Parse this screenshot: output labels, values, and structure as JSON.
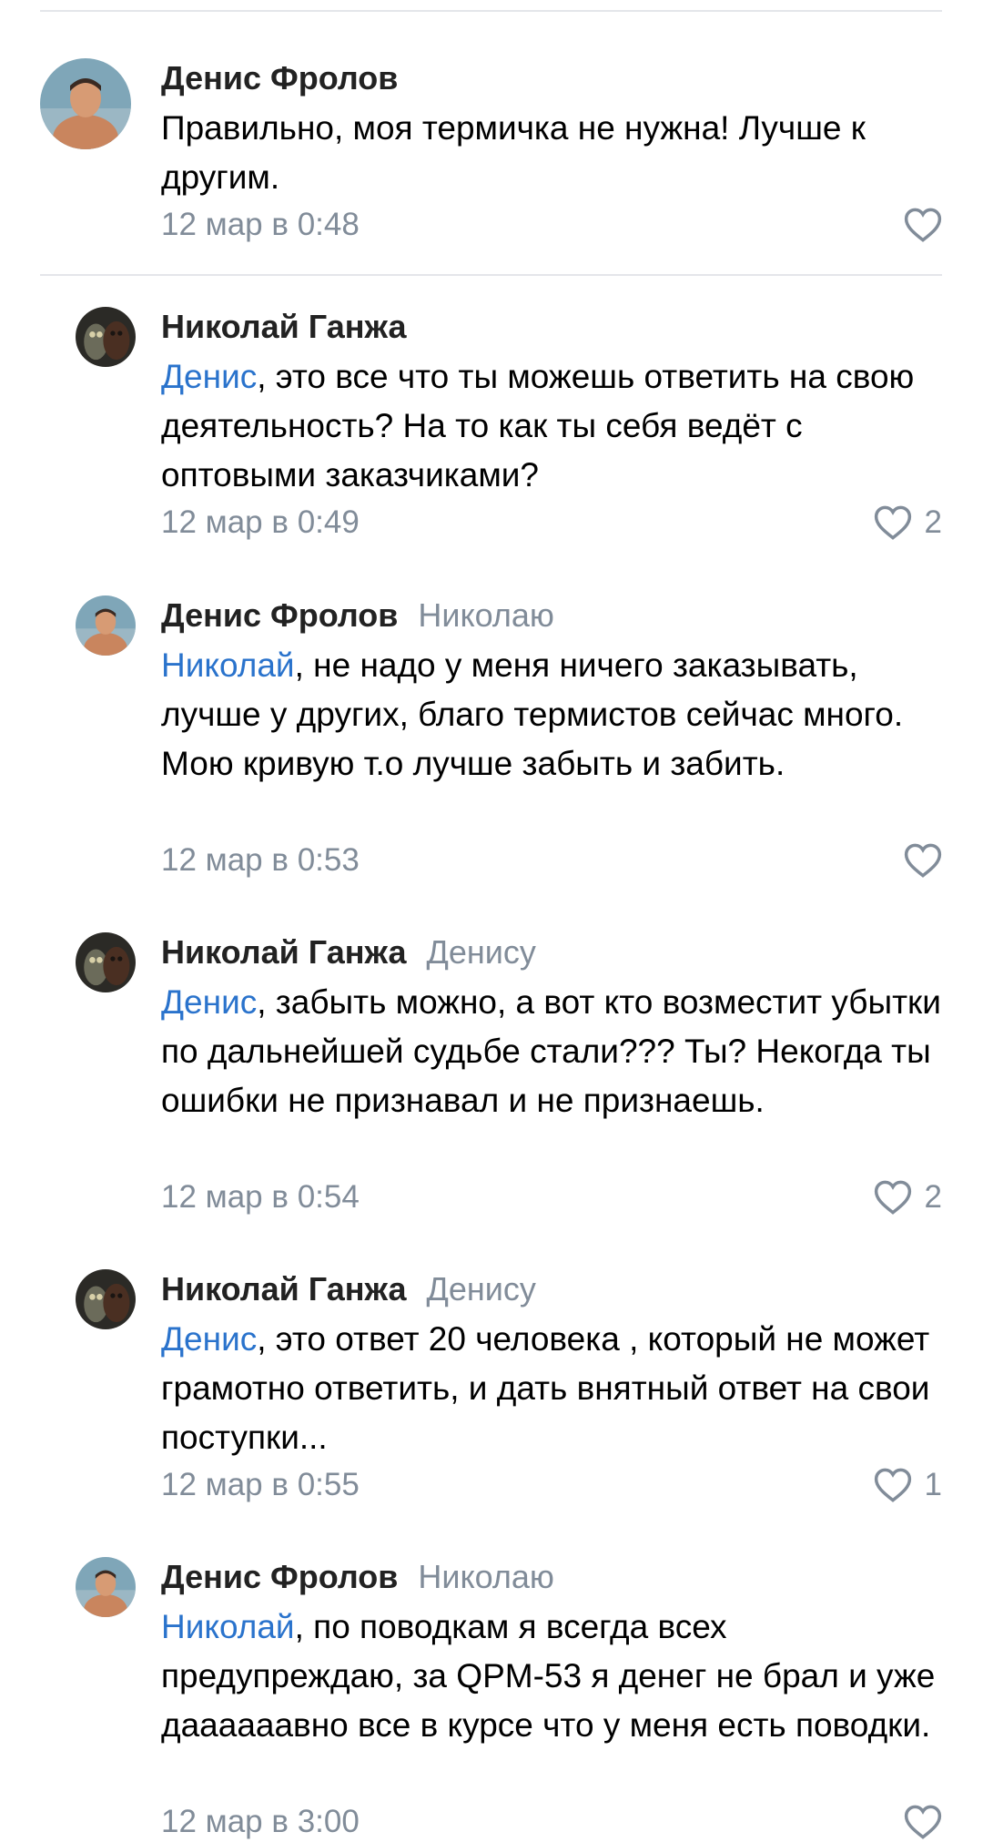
{
  "comments": [
    {
      "author": "Денис Фролов",
      "reply_to": "",
      "mention": "",
      "text": "Правильно, моя термичка не нужна! Лучше к другим.",
      "time": "12 мар в 0:48",
      "likes": ""
    },
    {
      "author": "Николай Ганжа",
      "reply_to": "",
      "mention": "Денис",
      "text": ", это все что ты можешь ответить на свою деятельность? На то как ты себя ведёт с оптовыми заказчиками?",
      "time": "12 мар в 0:49",
      "likes": "2"
    },
    {
      "author": "Денис Фролов",
      "reply_to": "Николаю",
      "mention": "Николай",
      "text": ", не надо у меня ничего заказывать, лучше у других, благо термистов сейчас много. Мою кривую т.о лучше забыть и забить.",
      "time": "12 мар в 0:53",
      "likes": ""
    },
    {
      "author": "Николай Ганжа",
      "reply_to": "Денису",
      "mention": "Денис",
      "text": ", забыть можно, а вот кто возместит убытки по дальнейшей судьбе стали??? Ты? Некогда ты ошибки не признавал и не признаешь.",
      "time": "12 мар в 0:54",
      "likes": "2"
    },
    {
      "author": "Николай Ганжа",
      "reply_to": "Денису",
      "mention": "Денис",
      "text": ", это ответ 20 человека , который не может грамотно ответить, и дать внятный ответ на свои поступки...",
      "time": "12 мар в 0:55",
      "likes": "1"
    },
    {
      "author": "Денис Фролов",
      "reply_to": "Николаю",
      "mention": "Николай",
      "text": ", по поводкам я всегда всех предупреждаю, за QPM-53 я денег не брал и уже даааааавно все в курсе что у меня есть поводки.",
      "time": "12 мар в 3:00",
      "likes": ""
    }
  ],
  "colors": {
    "mention": "#2a73cc",
    "meta": "#818c99",
    "divider": "#e4e6ea"
  },
  "icons": {
    "like": "heart-outline-icon"
  }
}
